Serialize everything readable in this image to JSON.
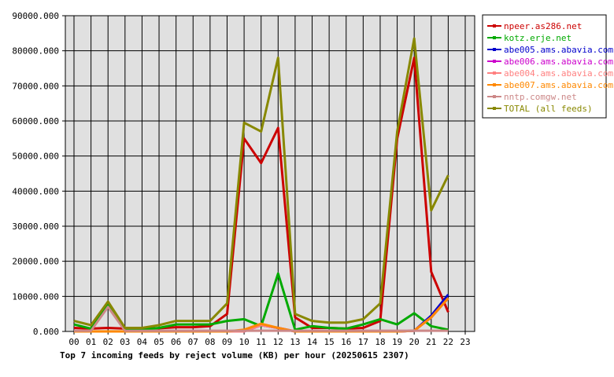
{
  "chart_data": {
    "type": "line",
    "title": "Top 7 incoming feeds by reject volume (KB) per hour (20250615 2307)",
    "categories": [
      "00",
      "01",
      "02",
      "03",
      "04",
      "05",
      "06",
      "07",
      "08",
      "09",
      "10",
      "11",
      "12",
      "13",
      "14",
      "15",
      "16",
      "17",
      "18",
      "19",
      "20",
      "21",
      "22",
      "23"
    ],
    "y_ticks": [
      "0.000",
      "10000.000",
      "20000.000",
      "30000.000",
      "40000.000",
      "50000.000",
      "60000.000",
      "70000.000",
      "80000.000",
      "90000.000"
    ],
    "ylim": [
      0,
      90000
    ],
    "grid": true,
    "legend_position": "right",
    "series": [
      {
        "name": "npeer.as286.net",
        "color": "#cc0000",
        "values": [
          1000,
          800,
          1000,
          800,
          800,
          900,
          1200,
          1200,
          1500,
          5000,
          55000,
          48000,
          58000,
          4000,
          1000,
          1000,
          800,
          1000,
          3000,
          55000,
          78000,
          17000,
          5500,
          null
        ]
      },
      {
        "name": "kotz.erje.net",
        "color": "#00aa00",
        "values": [
          2000,
          800,
          8000,
          600,
          500,
          1000,
          2000,
          2000,
          2000,
          3000,
          3500,
          1500,
          16500,
          500,
          1500,
          1000,
          800,
          2000,
          3500,
          2000,
          5200,
          1500,
          500,
          null
        ]
      },
      {
        "name": "abe005.ams.abavia.com",
        "color": "#0000cc",
        "values": [
          0,
          0,
          0,
          0,
          0,
          0,
          0,
          0,
          0,
          0,
          0,
          1800,
          1000,
          0,
          0,
          0,
          0,
          0,
          0,
          0,
          200,
          4500,
          10500,
          null
        ]
      },
      {
        "name": "abe006.ams.abavia.com",
        "color": "#cc00cc",
        "values": [
          0,
          0,
          0,
          0,
          0,
          0,
          0,
          0,
          0,
          0,
          0,
          1800,
          1000,
          0,
          0,
          0,
          0,
          0,
          0,
          0,
          200,
          4000,
          9500,
          null
        ]
      },
      {
        "name": "abe004.ams.abavia.com",
        "color": "#ff8080",
        "values": [
          0,
          0,
          0,
          0,
          0,
          0,
          0,
          0,
          0,
          0,
          0,
          1800,
          1000,
          0,
          0,
          0,
          0,
          0,
          0,
          0,
          200,
          4000,
          9500,
          null
        ]
      },
      {
        "name": "abe007.ams.abavia.com",
        "color": "#ff8800",
        "values": [
          0,
          0,
          0,
          0,
          0,
          0,
          0,
          0,
          0,
          0,
          500,
          2200,
          1000,
          0,
          0,
          0,
          0,
          0,
          0,
          0,
          200,
          4000,
          9500,
          null
        ]
      },
      {
        "name": "nntp.comgw.net",
        "color": "#cc8888",
        "values": [
          200,
          200,
          7000,
          200,
          200,
          200,
          200,
          200,
          200,
          200,
          200,
          200,
          200,
          200,
          200,
          200,
          200,
          200,
          200,
          200,
          200,
          200,
          200,
          null
        ]
      },
      {
        "name": "TOTAL (all feeds)",
        "color": "#888800",
        "values": [
          3000,
          1800,
          8500,
          1000,
          1000,
          1800,
          3000,
          3000,
          3000,
          8000,
          59500,
          57000,
          78000,
          5000,
          3000,
          2500,
          2500,
          3500,
          8000,
          57000,
          83500,
          34500,
          44500,
          null
        ]
      }
    ]
  }
}
